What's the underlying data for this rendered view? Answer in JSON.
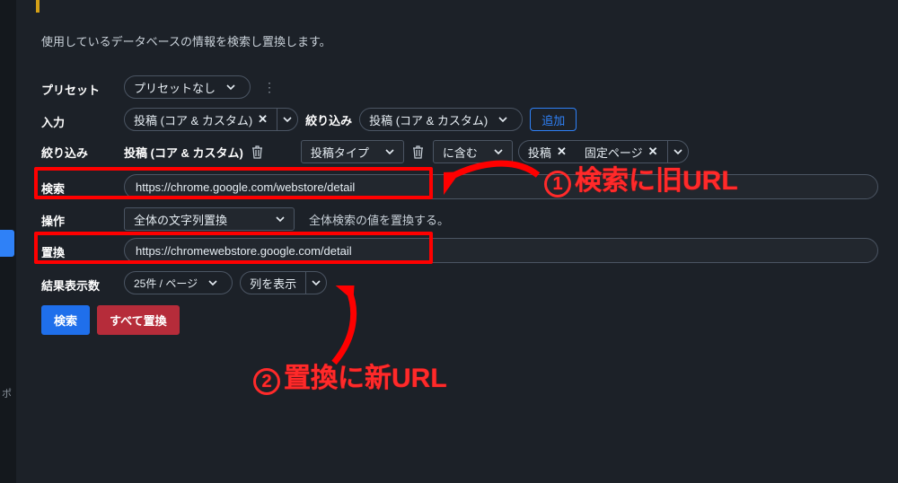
{
  "description": "使用しているデータベースの情報を検索し置換します。",
  "labels": {
    "preset": "プリセット",
    "input": "入力",
    "filter": "絞り込み",
    "search": "検索",
    "operation": "操作",
    "replace": "置換",
    "results": "結果表示数"
  },
  "preset": {
    "value": "プリセットなし"
  },
  "input": {
    "value": "投稿 (コア & カスタム)",
    "filter_label": "絞り込み",
    "filter_value": "投稿 (コア & カスタム)",
    "add_label": "追加"
  },
  "filter_row": {
    "item": "投稿 (コア & カスタム)",
    "post_type": "投稿タイプ",
    "contains": "に含む",
    "tag1": "投稿",
    "tag2": "固定ページ"
  },
  "search": {
    "value": "https://chrome.google.com/webstore/detail"
  },
  "operation": {
    "value": "全体の文字列置換",
    "help": "全体検索の値を置換する。"
  },
  "replace": {
    "value": "https://chromewebstore.google.com/detail"
  },
  "results": {
    "per_page": "25件 / ページ",
    "columns": "列を表示"
  },
  "buttons": {
    "search": "検索",
    "replace_all": "すべて置換"
  },
  "annotations": {
    "a1_num": "1",
    "a1_text": "検索に旧URL",
    "a2_num": "2",
    "a2_text": "置換に新URL"
  },
  "leftbar_label": "ポ"
}
